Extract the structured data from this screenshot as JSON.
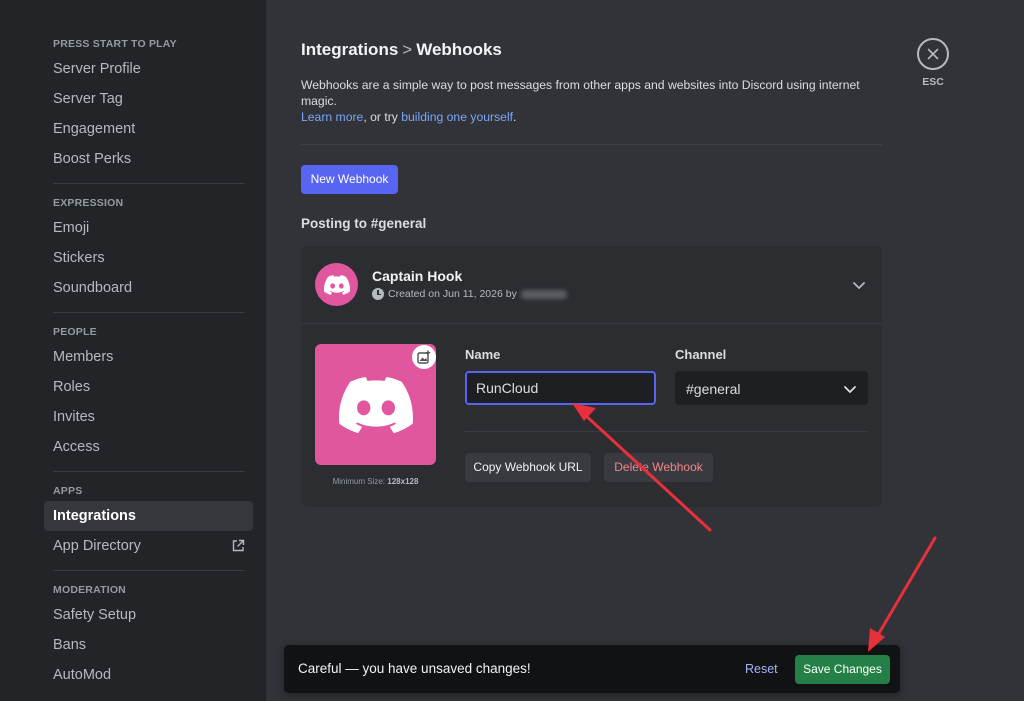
{
  "sidebar": {
    "sections": [
      {
        "header": "PRESS START TO PLAY",
        "items": [
          "Server Profile",
          "Server Tag",
          "Engagement",
          "Boost Perks"
        ]
      },
      {
        "header": "EXPRESSION",
        "items": [
          "Emoji",
          "Stickers",
          "Soundboard"
        ]
      },
      {
        "header": "PEOPLE",
        "items": [
          "Members",
          "Roles",
          "Invites",
          "Access"
        ]
      },
      {
        "header": "APPS",
        "items": [
          "Integrations",
          "App Directory"
        ]
      },
      {
        "header": "MODERATION",
        "items": [
          "Safety Setup",
          "Bans",
          "AutoMod"
        ]
      }
    ],
    "active_item": "Integrations"
  },
  "header": {
    "crumb_parent": "Integrations",
    "crumb_sep": ">",
    "crumb_current": "Webhooks"
  },
  "description": {
    "text": "Webhooks are a simple way to post messages from other apps and websites into Discord using internet magic.",
    "learn_more": "Learn more",
    "middle": ", or try ",
    "build_link": "building one yourself",
    "end": "."
  },
  "new_webhook_label": "New Webhook",
  "posting_label": "Posting to #general",
  "webhook": {
    "name": "Captain Hook",
    "created": "Created on Jun 11, 2026 by",
    "name_label": "Name",
    "name_value": "RunCloud",
    "channel_label": "Channel",
    "channel_value": "#general",
    "min_size_prefix": "Minimum Size: ",
    "min_size_value": "128x128",
    "copy_label": "Copy Webhook URL",
    "delete_label": "Delete Webhook"
  },
  "esc_label": "ESC",
  "unsaved": {
    "text": "Careful — you have unsaved changes!",
    "reset_label": "Reset",
    "save_label": "Save Changes"
  },
  "colors": {
    "accent": "#5865f2",
    "avatar_bg": "#e0569f",
    "save_green": "#248046",
    "danger": "#f38688",
    "annotation_arrow": "#e8303a"
  }
}
